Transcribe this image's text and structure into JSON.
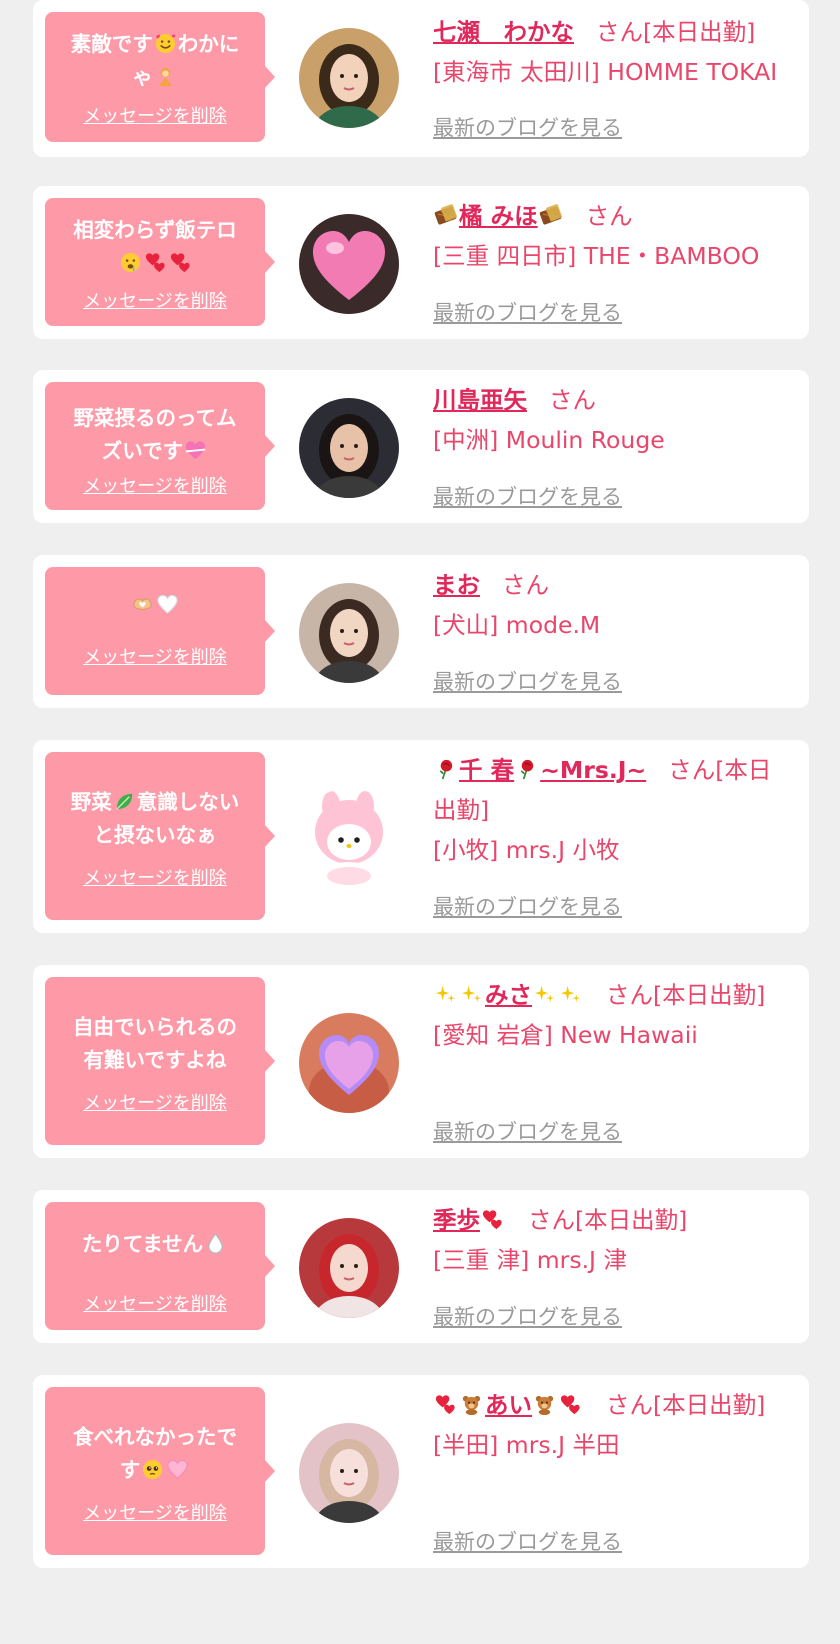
{
  "delete_label": "メッセージを削除",
  "blog_label": "最新のブログを見る",
  "san_label": "さん",
  "on_duty_label": "[本日出勤]",
  "colors": {
    "page_bg": "#efefef",
    "bubble_bg": "#fe9aa7",
    "accent": "#e0285a",
    "shop_text": "#e8466a",
    "link_gray": "#9a9a9a"
  },
  "messages": [
    {
      "message_lines": [
        [
          "素敵です",
          "smiling-hearts-emoji",
          "わかに"
        ],
        [
          "ゃ",
          "woman-emoji"
        ]
      ],
      "name_parts": [
        "七瀬　わかな"
      ],
      "on_duty": true,
      "shop": "[東海市 太田川] HOMME TOKAI",
      "avatar_icon": "avatar-photo"
    },
    {
      "message_lines": [
        [
          "相変わらず飯テロ"
        ],
        [
          "drooling-face-emoji",
          "heart-emoji",
          "heart-emoji"
        ]
      ],
      "name_parts": [
        "chocolate-bar-icon",
        "橘 みほ",
        "chocolate-bar-icon"
      ],
      "on_duty": false,
      "shop": "[三重 四日市] THE・BAMBOO",
      "avatar_icon": "avatar-pink-heart"
    },
    {
      "message_lines": [
        [
          "野菜摂るのってム"
        ],
        [
          "ズいです",
          "heart-ribbon-emoji"
        ]
      ],
      "name_parts": [
        "川島亜矢"
      ],
      "on_duty": false,
      "shop": "[中洲] Moulin Rouge",
      "avatar_icon": "avatar-photo"
    },
    {
      "message_lines": [
        [
          "heart-hands-emoji",
          "white-heart-emoji"
        ]
      ],
      "name_parts": [
        "まお"
      ],
      "on_duty": false,
      "shop": "[犬山] mode.M",
      "avatar_icon": "avatar-photo"
    },
    {
      "message_lines": [
        [
          "野菜",
          "leafy-green-emoji",
          "意識しない"
        ],
        [
          "と摂ないなぁ"
        ]
      ],
      "name_parts": [
        "rose-icon",
        "千 春",
        "rose-icon",
        "~Mrs.J~"
      ],
      "on_duty": true,
      "shop": "[小牧] mrs.J 小牧",
      "avatar_icon": "avatar-plush-toy"
    },
    {
      "message_lines": [
        [
          "自由でいられるの"
        ],
        [
          "有難いですよね"
        ]
      ],
      "name_parts": [
        "sparkles-icon",
        "sparkles-icon",
        "みさ",
        "sparkles-icon",
        "sparkles-icon"
      ],
      "on_duty": true,
      "shop": "[愛知 岩倉] New Hawaii",
      "avatar_icon": "avatar-heart-mosaic"
    },
    {
      "message_lines": [
        [
          "たりてません",
          "droplet-emoji"
        ]
      ],
      "name_parts": [
        "季歩",
        "heart-icon"
      ],
      "on_duty": true,
      "shop": "[三重 津] mrs.J 津",
      "avatar_icon": "avatar-photo"
    },
    {
      "message_lines": [
        [
          "食べれなかったで"
        ],
        [
          "す",
          "pleading-face-emoji",
          "pink-heart-emoji"
        ]
      ],
      "name_parts": [
        "heart-icon",
        "teddy-bear-icon",
        "あい",
        "teddy-bear-icon",
        "heart-icon"
      ],
      "on_duty": true,
      "shop": "[半田] mrs.J 半田",
      "avatar_icon": "avatar-photo"
    }
  ]
}
